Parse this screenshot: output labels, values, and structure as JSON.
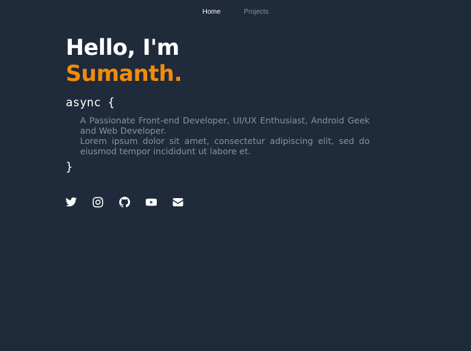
{
  "nav": {
    "items": [
      {
        "label": "Home",
        "active": true
      },
      {
        "label": "Projects",
        "active": false
      }
    ]
  },
  "hero": {
    "greeting": "Hello, I'm",
    "name": "Sumanth.",
    "code_open": "async {",
    "description_line1": "A Passionate Front-end Developer, UI/UX Enthusiast, Android Geek and Web Developer.",
    "description_line2": "Lorem ipsum dolor sit amet, consectetur adipiscing elit, sed do eiusmod tempor incididunt ut labore et.",
    "code_close": "}"
  },
  "socials": [
    {
      "icon": "twitter-icon"
    },
    {
      "icon": "instagram-icon"
    },
    {
      "icon": "github-icon"
    },
    {
      "icon": "youtube-icon"
    },
    {
      "icon": "mail-icon"
    }
  ],
  "colors": {
    "background": "#1f2a3a",
    "accent": "#f38b0c",
    "muted_text": "#8a93a0",
    "text": "#ffffff"
  }
}
